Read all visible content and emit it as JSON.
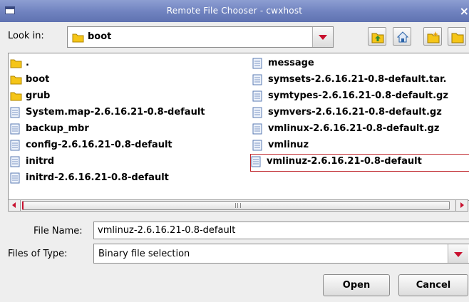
{
  "window": {
    "title": "Remote File Chooser - cwxhost",
    "close_glyph": "×"
  },
  "look_in": {
    "label": "Look in:",
    "value": "boot",
    "icon": "folder-icon"
  },
  "toolbar": {
    "buttons": [
      {
        "name": "up-one-level-button",
        "icon": "up-folder-icon"
      },
      {
        "name": "home-button",
        "icon": "home-icon"
      },
      {
        "name": "new-folder-button",
        "icon": "new-folder-icon"
      },
      {
        "name": "list-view-button",
        "icon": "list-view-icon"
      }
    ]
  },
  "files": {
    "column1": [
      {
        "name": ".",
        "type": "folder"
      },
      {
        "name": "boot",
        "type": "folder"
      },
      {
        "name": "grub",
        "type": "folder"
      },
      {
        "name": "System.map-2.6.16.21-0.8-default",
        "type": "file"
      },
      {
        "name": "backup_mbr",
        "type": "file"
      },
      {
        "name": "config-2.6.16.21-0.8-default",
        "type": "file"
      },
      {
        "name": "initrd",
        "type": "file"
      },
      {
        "name": "initrd-2.6.16.21-0.8-default",
        "type": "file"
      }
    ],
    "column2": [
      {
        "name": "message",
        "type": "file"
      },
      {
        "name": "symsets-2.6.16.21-0.8-default.tar.",
        "type": "file"
      },
      {
        "name": "symtypes-2.6.16.21-0.8-default.gz",
        "type": "file"
      },
      {
        "name": "symvers-2.6.16.21-0.8-default.gz",
        "type": "file"
      },
      {
        "name": "vmlinux-2.6.16.21-0.8-default.gz",
        "type": "file"
      },
      {
        "name": "vmlinuz",
        "type": "file"
      },
      {
        "name": "vmlinuz-2.6.16.21-0.8-default",
        "type": "file",
        "selected": true
      }
    ]
  },
  "scrollbar": {
    "grip_glyph": "|||"
  },
  "file_name": {
    "label": "File Name:",
    "value": "vmlinuz-2.6.16.21-0.8-default"
  },
  "file_type": {
    "label": "Files of Type:",
    "value": "Binary file selection"
  },
  "buttons": {
    "open": "Open",
    "cancel": "Cancel"
  },
  "colors": {
    "title_bar": "#7385c2",
    "accent_red": "#c8102e",
    "folder_yellow": "#f5c518",
    "selection_outline": "#c0272d"
  }
}
